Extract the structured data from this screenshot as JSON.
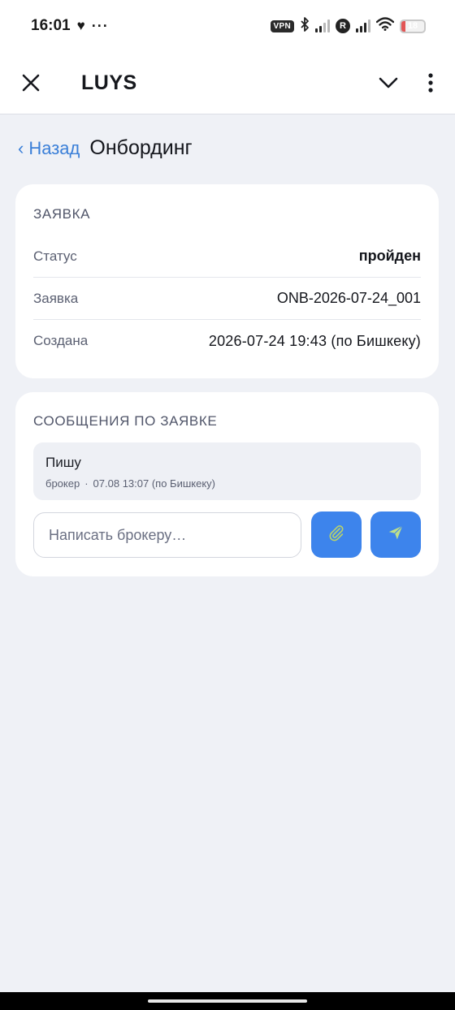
{
  "status_bar": {
    "time": "16:01",
    "heart_icon": "♥",
    "overflow_dots": "···",
    "vpn_label": "VPN",
    "roaming_letter": "R",
    "battery_level": "18",
    "battery_fraction": 0.18,
    "battery_color": "#e25555"
  },
  "header": {
    "title": "LUYS",
    "close_icon": "close-icon",
    "dropdown_icon": "chevron-down-icon",
    "menu_icon": "more-vertical-icon"
  },
  "breadcrumb": {
    "back_chevron": "‹",
    "back_label": "Назад",
    "page_title": "Онбординг"
  },
  "request_card": {
    "heading": "ЗАЯВКА",
    "rows": [
      {
        "key": "Статус",
        "value": "пройден"
      },
      {
        "key": "Заявка",
        "value": "ONB-2026-07-24_001"
      },
      {
        "key": "Создана",
        "value": "2026-07-24 19:43 (по Бишкеку)"
      }
    ]
  },
  "messages_card": {
    "heading": "СООБЩЕНИЯ ПО ЗАЯВКЕ",
    "messages": [
      {
        "text": "Пишу",
        "author": "брокер",
        "separator": "·",
        "timestamp": "07.08 13:07 (по Бишкеку)"
      }
    ],
    "compose_placeholder": "Написать брокеру…",
    "attach_icon": "paperclip-icon",
    "send_icon": "send-icon"
  },
  "colors": {
    "accent": "#3d84ec",
    "link": "#3a7fd8",
    "background": "#eff1f6",
    "card": "#ffffff"
  }
}
